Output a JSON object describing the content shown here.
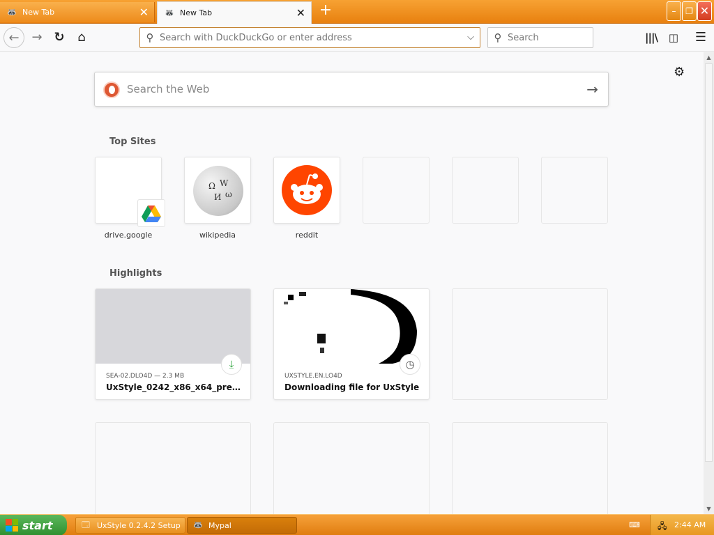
{
  "tabs": [
    {
      "label": "New Tab",
      "active": false
    },
    {
      "label": "New Tab",
      "active": true
    }
  ],
  "window_controls": {
    "minimize": "–",
    "maximize": "❐",
    "close": "✕"
  },
  "nav": {
    "url_placeholder": "Search with DuckDuckGo or enter address",
    "search_placeholder": "Search"
  },
  "newtab": {
    "web_search_placeholder": "Search the Web",
    "top_sites_title": "Top Sites",
    "top_sites": [
      {
        "label": "drive.google",
        "icon": "google-drive-icon"
      },
      {
        "label": "wikipedia",
        "icon": "wikipedia-globe-icon"
      },
      {
        "label": "reddit",
        "icon": "reddit-icon"
      },
      {
        "label": ""
      },
      {
        "label": ""
      },
      {
        "label": ""
      }
    ],
    "highlights_title": "Highlights",
    "highlights": [
      {
        "source": "SEA-02.DLO4D — 2.3 MB",
        "title": "UxStyle_0242_x86_x64_preview...",
        "badge": "download-icon"
      },
      {
        "source": "UXSTYLE.EN.LO4D",
        "title": "Downloading file for UxStyle",
        "badge": "clock-icon"
      }
    ]
  },
  "taskbar": {
    "start_label": "start",
    "tasks": [
      {
        "label": "UxStyle 0.2.4.2 Setup"
      },
      {
        "label": "Mypal"
      }
    ],
    "clock": "2:44 AM"
  },
  "colors": {
    "titlebar": "#f39c30",
    "urlbar_border": "#c48434",
    "ddg": "#de5833",
    "reddit": "#ff4500",
    "download_green": "#2aa33a"
  }
}
